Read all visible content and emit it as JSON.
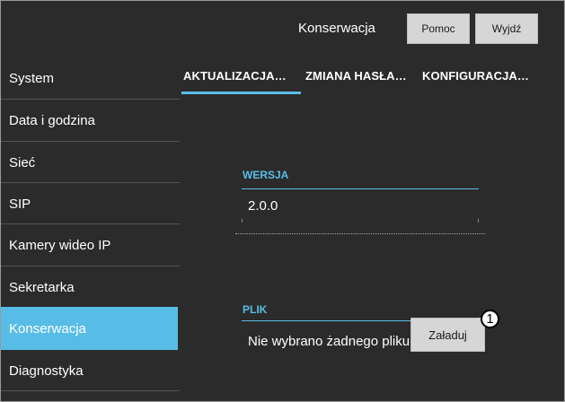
{
  "header": {
    "title": "Konserwacja",
    "help_label": "Pomoc",
    "exit_label": "Wyjdź"
  },
  "sidebar": {
    "items": [
      {
        "label": "System",
        "active": false
      },
      {
        "label": "Data i godzina",
        "active": false
      },
      {
        "label": "Sieć",
        "active": false
      },
      {
        "label": "SIP",
        "active": false
      },
      {
        "label": "Kamery wideo IP",
        "active": false
      },
      {
        "label": "Sekretarka",
        "active": false
      },
      {
        "label": "Konserwacja",
        "active": true
      },
      {
        "label": "Diagnostyka",
        "active": false
      }
    ]
  },
  "tabs": [
    {
      "label": "AKTUALIZACJA…",
      "active": true
    },
    {
      "label": "ZMIANA HASŁA…",
      "active": false
    },
    {
      "label": "KONFIGURACJA…",
      "active": false
    }
  ],
  "version": {
    "label": "WERSJA",
    "value": "2.0.0"
  },
  "file": {
    "label": "PLIK",
    "status": "Nie wybrano żadnego pliku",
    "upload_label": "Załaduj"
  },
  "callout": {
    "number": "1"
  },
  "colors": {
    "background": "#2b2b2b",
    "accent": "#58bde6",
    "button": "#d6d6d6",
    "text": "#ffffff"
  }
}
